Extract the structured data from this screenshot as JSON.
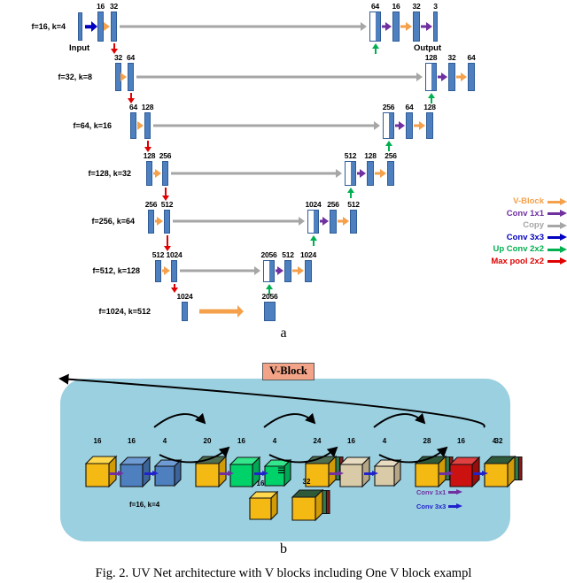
{
  "figure": {
    "caption": "Fig. 2.   UV Net architecture with V blocks including One V block exampl",
    "panel_a_letter": "a",
    "panel_b_letter": "b"
  },
  "colors": {
    "bar_fill": "#4E7FBF",
    "bar_stroke": "#2F5C97",
    "vblock_arrow": "#F5A04A",
    "conv1x1_arrow": "#7030A0",
    "copy_arrow": "#A6A6A6",
    "conv3x3_arrow": "#0000C0",
    "upconv_arrow": "#00B050",
    "maxpool_arrow": "#E00000",
    "panel_b_bg": "#9BD0E0",
    "vblock_title_bg": "#F3A387"
  },
  "panel_a": {
    "input_label": "Input",
    "output_label": "Output",
    "rows": [
      {
        "row_label": "f=16, k=4",
        "down_numbers": [
          "16",
          "32"
        ],
        "up_numbers": [
          "64",
          "16",
          "32",
          "3"
        ]
      },
      {
        "row_label": "f=32, k=8",
        "down_numbers": [
          "32",
          "64"
        ],
        "up_numbers": [
          "128",
          "32",
          "64"
        ]
      },
      {
        "row_label": "f=64, k=16",
        "down_numbers": [
          "64",
          "128"
        ],
        "up_numbers": [
          "256",
          "64",
          "128"
        ]
      },
      {
        "row_label": "f=128, k=32",
        "down_numbers": [
          "128",
          "256"
        ],
        "up_numbers": [
          "512",
          "128",
          "256"
        ]
      },
      {
        "row_label": "f=256, k=64",
        "down_numbers": [
          "256",
          "512"
        ],
        "up_numbers": [
          "1024",
          "256",
          "512"
        ]
      },
      {
        "row_label": "f=512, k=128",
        "down_numbers": [
          "512",
          "1024"
        ],
        "up_numbers": [
          "2056",
          "512",
          "1024"
        ]
      },
      {
        "row_label": "f=1024, k=512",
        "down_numbers": [
          "1024"
        ],
        "up_numbers": [
          "2056"
        ]
      }
    ],
    "legend": [
      {
        "label": "V-Block",
        "color": "#F5A04A"
      },
      {
        "label": "Conv 1x1",
        "color": "#7030A0"
      },
      {
        "label": "Copy",
        "color": "#A6A6A6"
      },
      {
        "label": "Conv 3x3",
        "color": "#0000C0"
      },
      {
        "label": "Up Conv 2x2",
        "color": "#00B050"
      },
      {
        "label": "Max pool 2x2",
        "color": "#E00000"
      }
    ]
  },
  "panel_b": {
    "title": "V-Block",
    "cube_numbers": [
      "16",
      "16",
      "4",
      "20",
      "16",
      "4",
      "24",
      "16",
      "4",
      "28",
      "16",
      "4",
      "32"
    ],
    "equals_symbol": "≡",
    "inset_label": "f=16, k=4",
    "inset_numbers": [
      "16",
      "32"
    ],
    "legend": [
      {
        "label": "Conv 1x1",
        "color": "#7030A0"
      },
      {
        "label": "Conv 3x3",
        "color": "#2222CC"
      }
    ]
  }
}
